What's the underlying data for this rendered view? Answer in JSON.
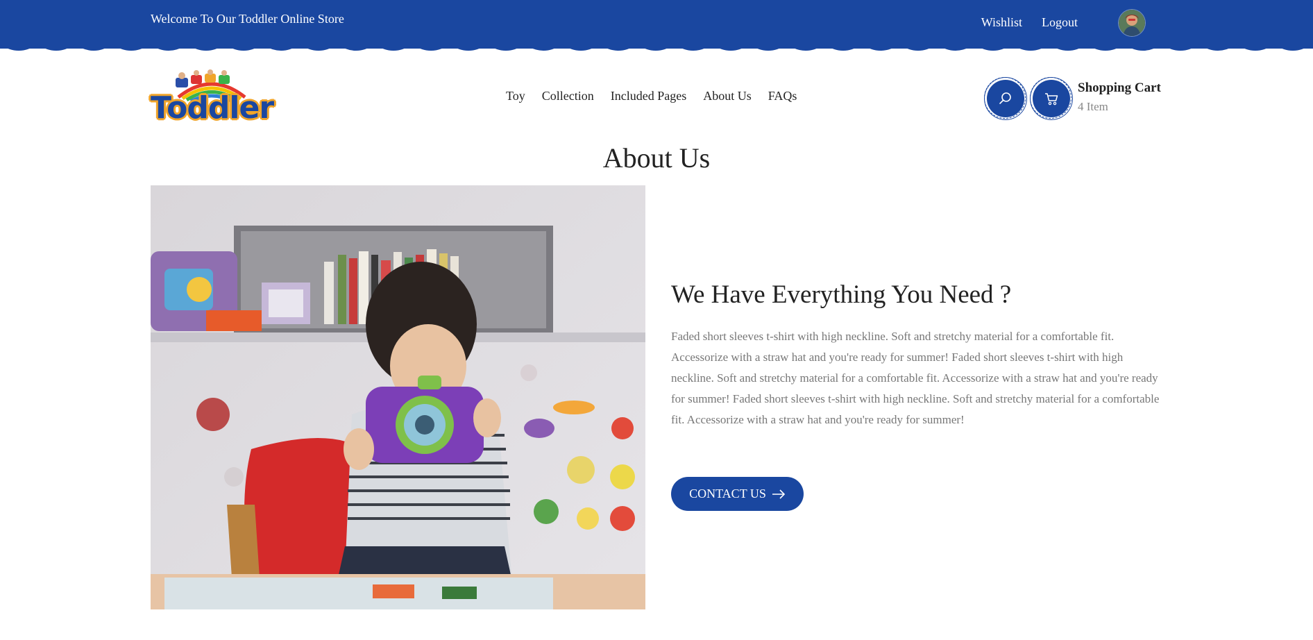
{
  "topbar": {
    "welcome": "Welcome To Our Toddler Online Store",
    "links": [
      "Wishlist",
      "Logout"
    ]
  },
  "header": {
    "logo_text": "Toddler",
    "nav": [
      "Toy",
      "Collection",
      "Included Pages",
      "About Us",
      "FAQs"
    ],
    "icons": {
      "search": "search-icon",
      "cart": "cart-icon"
    },
    "cart_title": "Shopping Cart",
    "cart_count": "4 Item"
  },
  "main": {
    "page_title": "About Us",
    "headline": "We Have Everything You Need ?",
    "body": "Faded short sleeves t-shirt with high neckline. Soft and stretchy material for a comfortable fit. Accessorize with a straw hat and you're ready for summer! Faded short sleeves t-shirt with high neckline. Soft and stretchy material for a comfortable fit. Accessorize with a straw hat and you're ready for summer! Faded short sleeves t-shirt with high neckline. Soft and stretchy material for a comfortable fit. Accessorize with a straw hat and you're ready for summer!",
    "cta_label": "CONTACT US"
  },
  "colors": {
    "brand_blue": "#1a47a0",
    "logo_orange": "#f0a52b",
    "text_dark": "#222222",
    "text_muted": "#777777"
  }
}
